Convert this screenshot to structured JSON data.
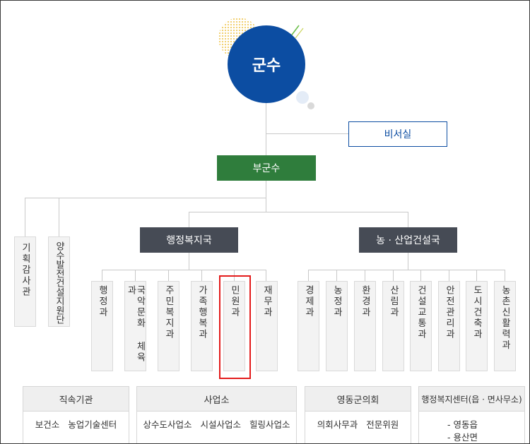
{
  "top": {
    "head_title": "군수",
    "secretary": "비서실",
    "deputy": "부군수"
  },
  "staff_units": [
    {
      "label": "기획감사관"
    },
    {
      "label": "양수발전건설지원단"
    }
  ],
  "bureaus": [
    {
      "label": "행정복지국",
      "departments": [
        {
          "label": "행정과"
        },
        {
          "label": "국악문화 체육과"
        },
        {
          "label": "주민복지과"
        },
        {
          "label": "가족행복과"
        },
        {
          "label": "민원과",
          "highlighted": true
        },
        {
          "label": "재무과"
        }
      ]
    },
    {
      "label": "농 · 산업건설국",
      "departments": [
        {
          "label": "경제과"
        },
        {
          "label": "농정과"
        },
        {
          "label": "환경과"
        },
        {
          "label": "산림과"
        },
        {
          "label": "건설교통과"
        },
        {
          "label": "안전관리과"
        },
        {
          "label": "도시건축과"
        },
        {
          "label": "농촌신활력과"
        }
      ]
    }
  ],
  "sections": [
    {
      "title": "직속기관",
      "items": [
        "보건소",
        "농업기술센터"
      ]
    },
    {
      "title": "사업소",
      "items": [
        "상수도사업소",
        "시설사업소",
        "힐링사업소"
      ]
    },
    {
      "title": "영동군의회",
      "items": [
        "의회사무과",
        "전문위원"
      ]
    },
    {
      "title": "행정복지센터(읍 · 면사무소)",
      "items": [
        "- 영동읍",
        "- 용산면"
      ]
    }
  ],
  "colors": {
    "head_blue": "#0c4da2",
    "deputy_green": "#2f7d3c",
    "bureau_dark": "#464b55",
    "line_gray": "#c9c9c9",
    "dept_bg": "#f3f3f3",
    "dept_border": "#dadada",
    "highlight_red": "#e31b1b",
    "section_head_bg": "#efefef",
    "section_border": "#d6d6d6",
    "deco_yellow": "#f1cc63"
  }
}
